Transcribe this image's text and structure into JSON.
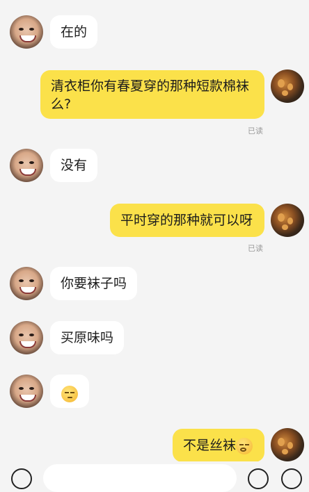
{
  "messages": {
    "m1": "在的",
    "m2": "清衣柜你有春夏穿的那种短款棉袜么?",
    "m2_status": "已读",
    "m3": "没有",
    "m4": "平时穿的那种就可以呀",
    "m4_status": "已读",
    "m5": "你要袜子吗",
    "m6": "买原味吗",
    "m8": "不是丝袜"
  },
  "icons": {
    "m7_emoji": "smirk-emoji-icon",
    "m8_emoji": "drooling-emoji-icon"
  },
  "colors": {
    "background": "#f4f4f4",
    "incoming_bubble": "#ffffff",
    "outgoing_bubble": "#fbe14a",
    "read_status": "#9a9a9a"
  }
}
